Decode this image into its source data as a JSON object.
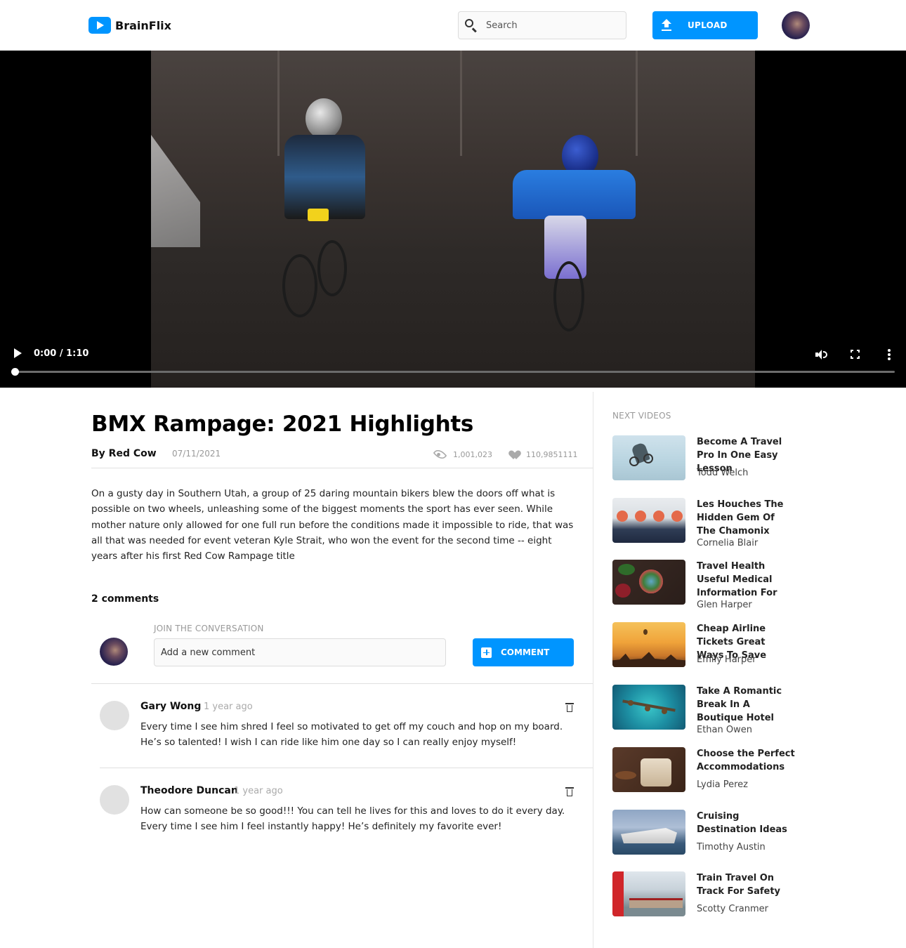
{
  "header": {
    "logo_text": "BrainFlix",
    "search_placeholder": "Search",
    "upload_label": "UPLOAD"
  },
  "player": {
    "time": "0:00 / 1:10",
    "progress": 0
  },
  "video": {
    "title": "BMX Rampage: 2021 Highlights",
    "author": "By Red Cow",
    "date": "07/11/2021",
    "views": "1,001,023",
    "likes": "110,9851111",
    "description": "On a gusty day in Southern Utah, a group of 25 daring mountain bikers blew the doors off what is possible on two wheels, unleashing some of the biggest moments the sport has ever seen. While mother nature only allowed for one full run before the conditions made it impossible to ride, that was all that was needed for event veteran Kyle Strait, who won the event for the second time -- eight years after his first Red Cow Rampage title"
  },
  "comments_section": {
    "count_label": "2 comments",
    "join_label": "JOIN THE CONVERSATION",
    "input_placeholder": "Add a new comment",
    "button_label": "COMMENT",
    "comments": [
      {
        "name": "Gary Wong",
        "time": "1 year ago",
        "text": "Every time I see him shred I feel so motivated to get off my couch and hop on my board. He’s so talented! I wish I can ride like him one day so I can really enjoy myself!"
      },
      {
        "name": "Theodore Duncan",
        "time": "1 year ago",
        "text": "How can someone be so good!!! You can tell he lives for this and loves to do it every day. Every time I see him I feel instantly happy! He’s definitely my favorite ever!"
      }
    ]
  },
  "sidebar": {
    "heading": "NEXT VIDEOS",
    "videos": [
      {
        "title": "Become A Travel Pro In One Easy Lesson",
        "author": "Todd Welch"
      },
      {
        "title": "Les Houches The Hidden Gem Of The Chamonix",
        "author": "Cornelia Blair"
      },
      {
        "title": "Travel Health Useful Medical Information For",
        "author": "Glen Harper"
      },
      {
        "title": "Cheap Airline Tickets Great Ways To Save",
        "author": "Emily Harper"
      },
      {
        "title": "Take A Romantic Break In A Boutique Hotel",
        "author": "Ethan Owen"
      },
      {
        "title": "Choose the Perfect Accommodations",
        "author": "Lydia Perez"
      },
      {
        "title": "Cruising Destination Ideas",
        "author": "Timothy Austin"
      },
      {
        "title": "Train Travel On Track For Safety",
        "author": "Scotty Cranmer"
      }
    ]
  },
  "colors": {
    "accent": "#0095FF",
    "muted_text": "#999999",
    "divider": "#E0E0E0"
  }
}
